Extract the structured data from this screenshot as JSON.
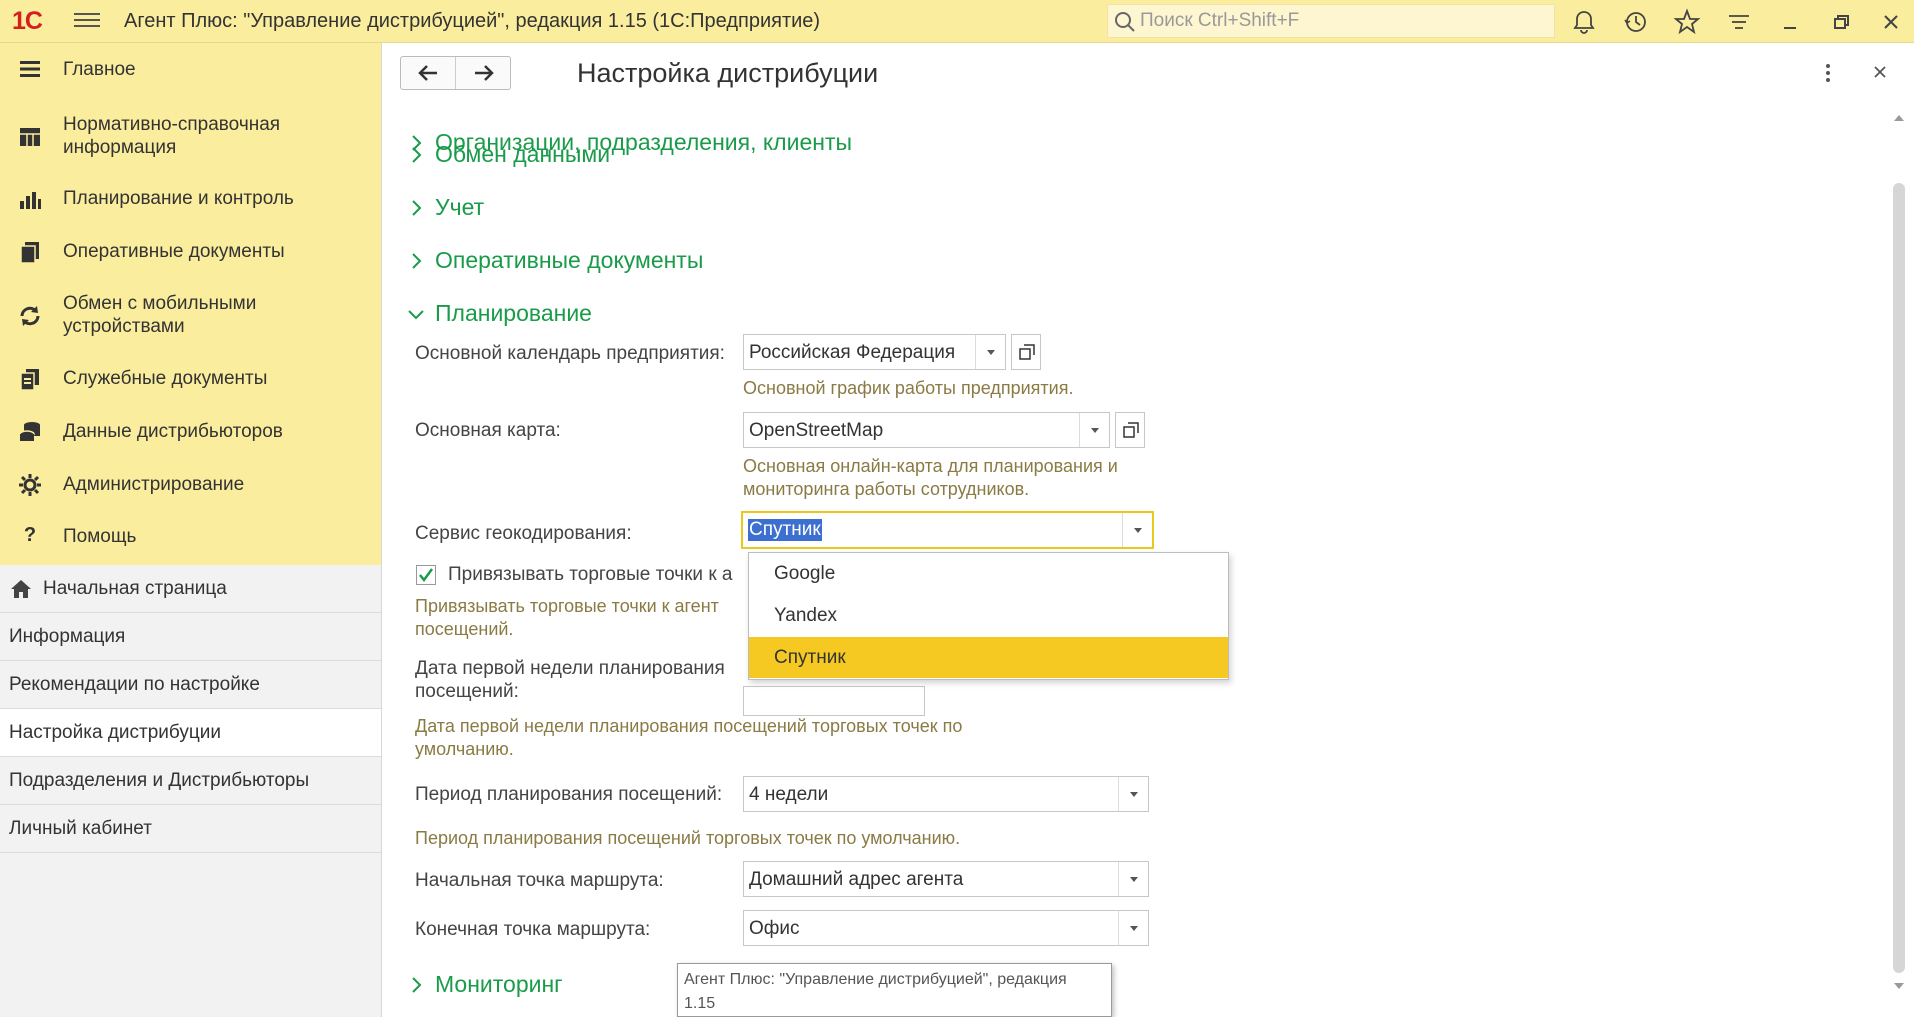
{
  "titlebar": {
    "logo": "1С",
    "title": "Агент Плюс: \"Управление дистрибуцией\", редакция 1.15  (1С:Предприятие)",
    "search_placeholder": "Поиск Ctrl+Shift+F",
    "icons": [
      "bell-icon",
      "history-icon",
      "star-icon",
      "menu-lines-icon",
      "minimize-icon",
      "restore-icon",
      "close-icon"
    ]
  },
  "sections": [
    {
      "label": "Главное",
      "icon": "menu-lines-icon"
    },
    {
      "label": "Нормативно-справочная информация",
      "icon": "table-icon"
    },
    {
      "label": "Планирование и контроль",
      "icon": "bar-chart-icon"
    },
    {
      "label": "Оперативные документы",
      "icon": "documents-icon"
    },
    {
      "label": "Обмен с мобильными устройствами",
      "icon": "sync-icon"
    },
    {
      "label": "Служебные документы",
      "icon": "service-docs-icon"
    },
    {
      "label": "Данные дистрибьюторов",
      "icon": "database-icon"
    },
    {
      "label": "Администрирование",
      "icon": "gear-icon"
    },
    {
      "label": "Помощь",
      "icon": "question-icon"
    }
  ],
  "open_windows": [
    {
      "label": "Начальная страница",
      "icon": "home-icon"
    },
    {
      "label": "Информация"
    },
    {
      "label": "Рекомендации по настройке"
    },
    {
      "label": "Настройка дистрибуции",
      "active": true
    },
    {
      "label": "Подразделения и Дистрибьюторы"
    },
    {
      "label": "Личный кабинет"
    }
  ],
  "form": {
    "title": "Настройка дистрибуции",
    "groups": {
      "org": "Организации, подразделения, клиенты",
      "exchange": "Обмен данными",
      "accounting": "Учет",
      "operative": "Оперативные документы",
      "planning": "Планирование",
      "monitoring": "Мониторинг"
    },
    "calendar": {
      "label": "Основной календарь предприятия:",
      "value": "Российская Федерация",
      "hint": "Основной график работы предприятия."
    },
    "map": {
      "label": "Основная карта:",
      "value": "OpenStreetMap",
      "hint_line1": "Основная онлайн-карта для планирования и",
      "hint_line2": "мониторинга работы сотрудников."
    },
    "geocoding": {
      "label": "Сервис геокодирования:",
      "value": "Спутник",
      "options": [
        "Google",
        "Yandex",
        "Спутник"
      ],
      "selected": "Спутник"
    },
    "bind": {
      "label": "Привязывать торговые точки к а",
      "checked": true,
      "hint_line1": "Привязывать торговые точки к агент",
      "hint_line2": "посещений."
    },
    "first_week": {
      "label_line1": "Дата первой недели планирования",
      "label_line2": "посещений:",
      "hint_line1": "Дата первой недели планирования посещений торговых точек по",
      "hint_line2": "умолчанию."
    },
    "period": {
      "label": "Период планирования посещений:",
      "value": "4 недели",
      "hint": "Период планирования посещений торговых точек по умолчанию."
    },
    "start_point": {
      "label": "Начальная точка маршрута:",
      "value": "Домашний адрес агента"
    },
    "end_point": {
      "label": "Конечная точка маршрута:",
      "value": "Офис"
    }
  },
  "tooltip": {
    "line1": "Агент Плюс: \"Управление дистрибуцией\", редакция",
    "line2": "1.15"
  },
  "colors": {
    "section_bg": "#fbed9e",
    "group_green": "#1a9b4a",
    "selected_item": "#f5c921",
    "hint": "#8a7a44",
    "logo_red": "#d3201f"
  }
}
